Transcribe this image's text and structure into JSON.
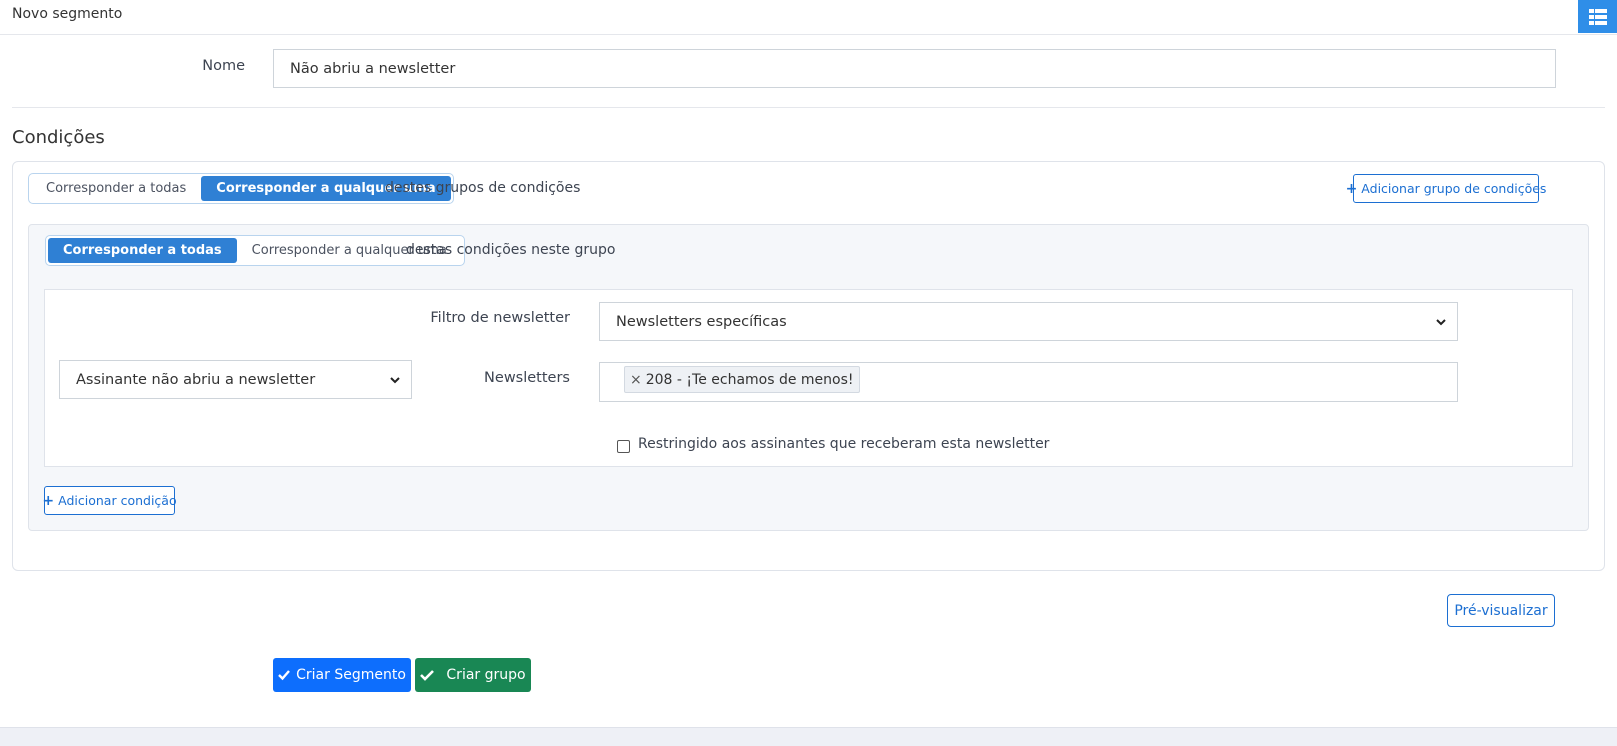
{
  "header": {
    "title": "Novo segmento",
    "menu_icon": "list-icon"
  },
  "name_field": {
    "label": "Nome",
    "value": "Não abriu a newsletter"
  },
  "conditions": {
    "heading": "Condições",
    "match_mode": {
      "options": [
        "Corresponder a todas",
        "Corresponder a qualquer uma"
      ],
      "selected": "Corresponder a qualquer uma"
    },
    "match_suffix": "destes grupos de condições",
    "add_group_label": "Adicionar grupo de condições",
    "group": {
      "match_mode": {
        "options": [
          "Corresponder a todas",
          "Corresponder a qualquer uma"
        ],
        "selected": "Corresponder a todas"
      },
      "match_suffix": "destas condições neste grupo",
      "condition": {
        "type_select": "Assinante não abriu a newsletter",
        "filter_label": "Filtro de newsletter",
        "filter_value": "Newsletters específicas",
        "newsletters_label": "Newsletters",
        "newsletters": [
          {
            "remove": "×",
            "label": "208 - ¡Te echamos de menos!"
          }
        ],
        "restrict_label": "Restringido aos assinantes que receberam esta newsletter",
        "restrict_checked": false
      },
      "add_condition_label": "Adicionar condição"
    }
  },
  "actions": {
    "preview_label": "Pré-visualizar",
    "create_segment_label": "Criar Segmento",
    "create_group_label": "Criar grupo"
  },
  "colors": {
    "primary": "#0d6efd",
    "success": "#198754",
    "segment_active": "#2f80d4",
    "menu": "#2f8ee8"
  }
}
